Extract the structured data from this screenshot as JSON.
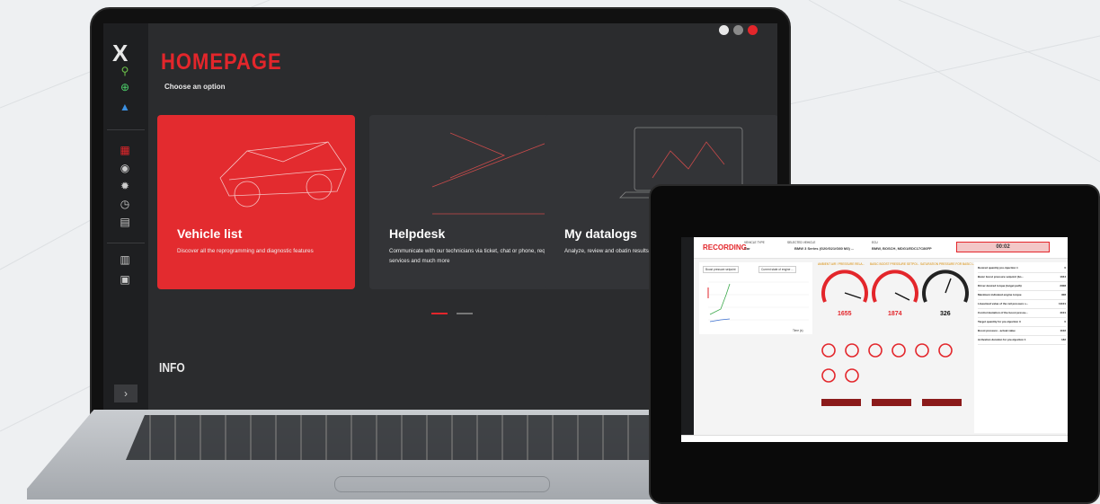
{
  "laptop": {
    "sidebar": {
      "logo": "X",
      "icons": [
        "usb-icon",
        "globe-icon",
        "boxes-icon",
        "dashboard-icon",
        "engine-icon",
        "settings-icon",
        "timer-icon",
        "document-icon",
        "book-icon",
        "calendar-icon"
      ],
      "expand_label": "›"
    },
    "title": "HOMEPAGE",
    "subtitle": "Choose an option",
    "cards": [
      {
        "title": "Vehicle list",
        "desc": "Discover all the reprogramming and diagnostic features"
      },
      {
        "title": "Helpdesk",
        "desc": "Communicate with our technicians via ticket, chat or phone, request services and much more"
      },
      {
        "title": "My datalogs",
        "desc": "Analyze, review and obatin results generated after datalogging sessi"
      }
    ],
    "info_title": "INFO",
    "window_controls": {
      "colors": [
        "#e8e8e8",
        "#8a8a8a",
        "#e3262b"
      ]
    }
  },
  "tablet": {
    "recording": "RECORDING",
    "vehicle_type_label": "VEHICLE TYPE",
    "vehicle_type": "Car",
    "selected_vehicle_label": "SELECTED VEHICLE",
    "selected_vehicle": "BMW 3 Series (G20/G21/G80 M3) ...",
    "ecu_label": "ECU",
    "ecu": "BMW, BOSCH, MDG1/EDC17C86FP",
    "timer": "00:02",
    "chart": {
      "select_1": "Boost pressure setpoint",
      "select_2": "Current state of engine ...",
      "time_label": "Time (s)"
    },
    "gauge_warnings": [
      "AMBIENT AIR / PRESSURE RELA...",
      "BASIC BOOST PRESSURE SETPOI...",
      "SATURATION PRESSURE FOR BASIC L..."
    ],
    "big_gauges": [
      1655,
      1874,
      326
    ],
    "list": [
      {
        "label": "Desired quantity pre-injection 1",
        "value": "0"
      },
      {
        "label": "Basic boost pressure setpoint (bo...",
        "value": "1044"
      },
      {
        "label": "Driver desired torque (target path)",
        "value": "2308"
      },
      {
        "label": "Maximum indicated engine torque",
        "value": "308"
      },
      {
        "label": "Linearized value of the rail pressure s...",
        "value": "11101"
      },
      {
        "label": "Control deviation of the boost pressu...",
        "value": "4101"
      },
      {
        "label": "Target quantity for pre-injection 3",
        "value": "0"
      },
      {
        "label": "Boost pressure - actual value",
        "value": "1102"
      },
      {
        "label": "Activation duration for pre-injection 1",
        "value": "182"
      }
    ]
  }
}
